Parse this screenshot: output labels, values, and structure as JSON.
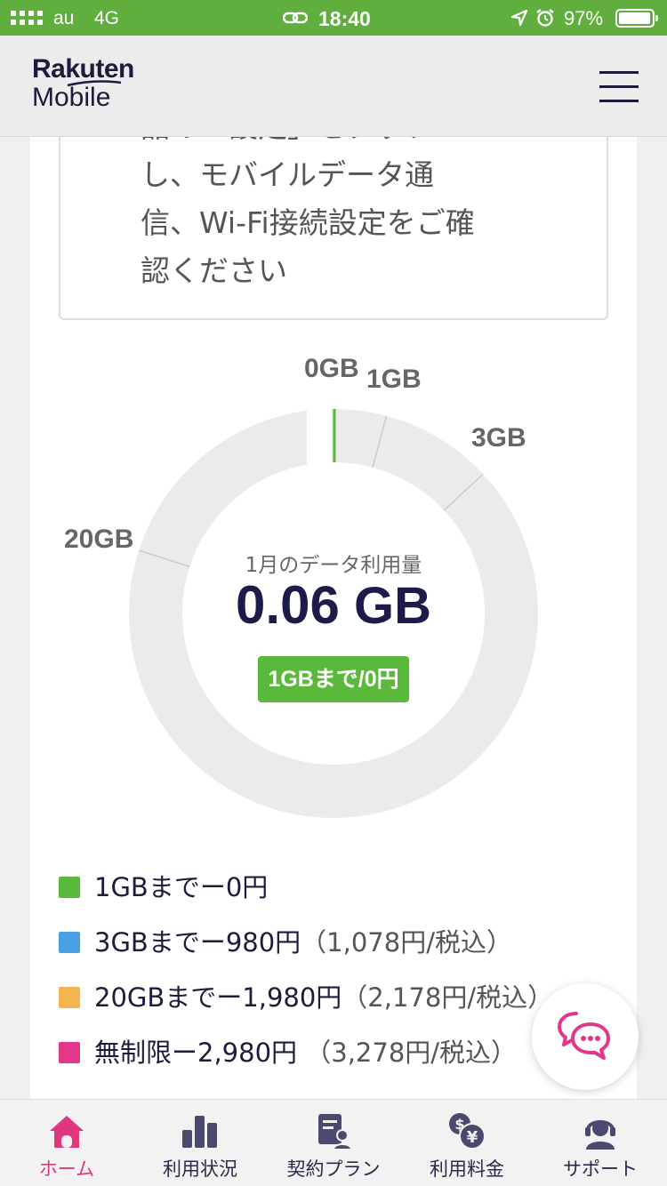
{
  "status_bar": {
    "carrier": "au",
    "network": "4G",
    "time": "18:40",
    "battery": "97%"
  },
  "header": {
    "logo_line1": "Rakuten",
    "logo_line2": "Mobile"
  },
  "notice": {
    "lines": [
      "品の「設定」をタップ",
      "し、モバイルデータ通",
      "信、Wi-Fi接続設定をご確",
      "認ください"
    ]
  },
  "usage": {
    "caption": "1月のデータ利用量",
    "value_number": "0.06",
    "value_unit": "GB",
    "used_gb": 0.06,
    "badge": "1GBまで/0円",
    "scale_labels": [
      "0GB",
      "1GB",
      "3GB",
      "20GB"
    ]
  },
  "legend": [
    {
      "color": "#5ab83a",
      "text": "1GBまでー0円",
      "tax": ""
    },
    {
      "color": "#4a9ee3",
      "text": "3GBまでー980円",
      "tax": "（1,078円/税込）"
    },
    {
      "color": "#f2b550",
      "text": "20GBまでー1,980円",
      "tax": "（2,178円/税込）"
    },
    {
      "color": "#e3388a",
      "text": "無制限ー2,980円",
      "tax": " （3,278円/税込）"
    }
  ],
  "colors": {
    "status_bar": "#5fae3e",
    "accent_pink": "#e0357f",
    "used_green": "#5ab83a",
    "ring": "#ebebeb",
    "nav_icon": "#4a4a6e"
  },
  "nav": [
    {
      "label": "ホーム",
      "icon": "home-icon",
      "active": true
    },
    {
      "label": "利用状況",
      "icon": "bar-chart-icon",
      "active": false
    },
    {
      "label": "契約プラン",
      "icon": "contract-icon",
      "active": false
    },
    {
      "label": "利用料金",
      "icon": "fee-icon",
      "active": false
    },
    {
      "label": "サポート",
      "icon": "support-icon",
      "active": false
    }
  ]
}
